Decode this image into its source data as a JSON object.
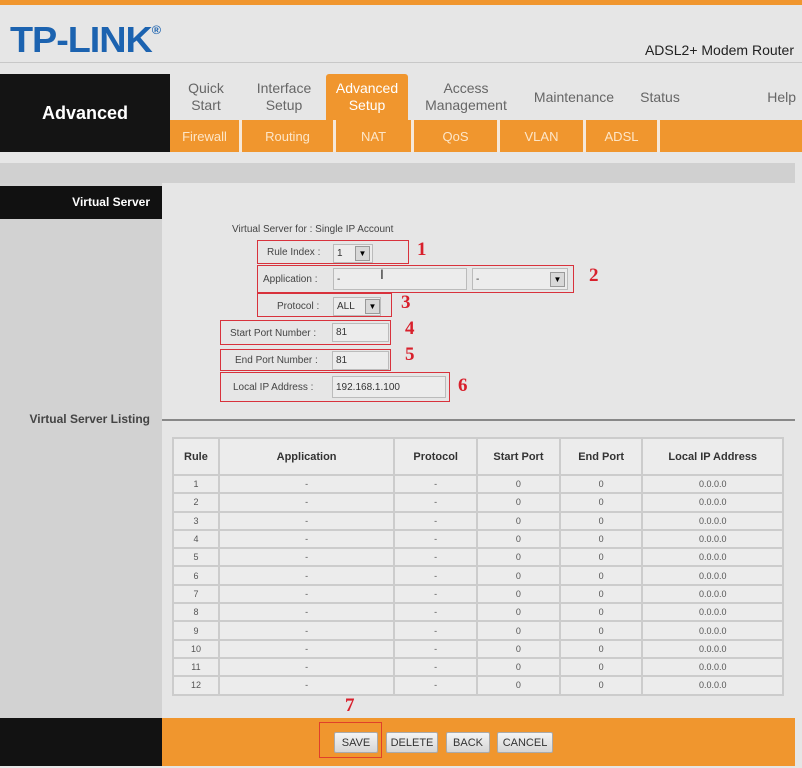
{
  "header": {
    "logo": "TP-LINK",
    "logo_mark": "®",
    "product": "ADSL2+ Modem Router"
  },
  "nav": {
    "section": "Advanced",
    "main_tabs": [
      {
        "label": "Quick Start",
        "active": false
      },
      {
        "label": "Interface Setup",
        "active": false
      },
      {
        "label": "Advanced Setup",
        "active": true
      },
      {
        "label": "Access Management",
        "active": false
      },
      {
        "label": "Maintenance",
        "active": false
      },
      {
        "label": "Status",
        "active": false
      },
      {
        "label": "Help",
        "active": false
      }
    ],
    "sub_tabs": [
      "Firewall",
      "Routing",
      "NAT",
      "QoS",
      "VLAN",
      "ADSL"
    ]
  },
  "sidebar": {
    "virtual_server": "Virtual Server",
    "virtual_server_listing": "Virtual Server Listing"
  },
  "form": {
    "virtual_server_for": "Virtual Server for : Single IP Account",
    "rule_index_label": "Rule Index :",
    "rule_index_value": "1",
    "application_label": "Application :",
    "application_value": "-",
    "application_select_value": "-",
    "protocol_label": "Protocol :",
    "protocol_value": "ALL",
    "start_port_label": "Start Port Number :",
    "start_port_value": "81",
    "end_port_label": "End Port Number :",
    "end_port_value": "81",
    "local_ip_label": "Local IP Address :",
    "local_ip_value": "192.168.1.100"
  },
  "annotations": [
    "1",
    "2",
    "3",
    "4",
    "5",
    "6",
    "7"
  ],
  "listing": {
    "columns": [
      "Rule",
      "Application",
      "Protocol",
      "Start Port",
      "End Port",
      "Local IP Address"
    ],
    "rows": [
      [
        "1",
        "-",
        "-",
        "0",
        "0",
        "0.0.0.0"
      ],
      [
        "2",
        "-",
        "-",
        "0",
        "0",
        "0.0.0.0"
      ],
      [
        "3",
        "-",
        "-",
        "0",
        "0",
        "0.0.0.0"
      ],
      [
        "4",
        "-",
        "-",
        "0",
        "0",
        "0.0.0.0"
      ],
      [
        "5",
        "-",
        "-",
        "0",
        "0",
        "0.0.0.0"
      ],
      [
        "6",
        "-",
        "-",
        "0",
        "0",
        "0.0.0.0"
      ],
      [
        "7",
        "-",
        "-",
        "0",
        "0",
        "0.0.0.0"
      ],
      [
        "8",
        "-",
        "-",
        "0",
        "0",
        "0.0.0.0"
      ],
      [
        "9",
        "-",
        "-",
        "0",
        "0",
        "0.0.0.0"
      ],
      [
        "10",
        "-",
        "-",
        "0",
        "0",
        "0.0.0.0"
      ],
      [
        "11",
        "-",
        "-",
        "0",
        "0",
        "0.0.0.0"
      ],
      [
        "12",
        "-",
        "-",
        "0",
        "0",
        "0.0.0.0"
      ]
    ]
  },
  "buttons": {
    "save": "SAVE",
    "delete": "DELETE",
    "back": "BACK",
    "cancel": "CANCEL"
  },
  "colors": {
    "accent": "#f0962e",
    "brand": "#1c63b0",
    "annotation": "#d8202c"
  }
}
